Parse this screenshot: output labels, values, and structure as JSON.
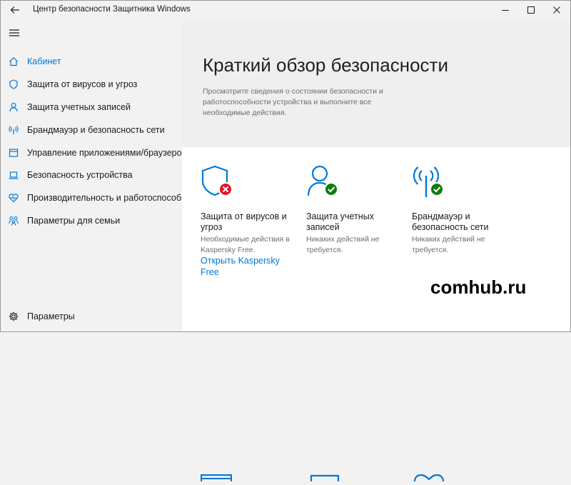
{
  "window": {
    "title": "Центр безопасности Защитника Windows"
  },
  "sidebar": {
    "items": [
      {
        "label": "Кабинет",
        "icon": "home-icon",
        "active": true
      },
      {
        "label": "Защита от вирусов и угроз",
        "icon": "shield-icon"
      },
      {
        "label": "Защита учетных записей",
        "icon": "person-icon"
      },
      {
        "label": "Брандмауэр и безопасность сети",
        "icon": "antenna-icon"
      },
      {
        "label": "Управление приложениями/браузером",
        "icon": "app-window-icon"
      },
      {
        "label": "Безопасность устройства",
        "icon": "laptop-icon"
      },
      {
        "label": "Производительность и работоспособность устройства",
        "icon": "heart-icon"
      },
      {
        "label": "Параметры для семьи",
        "icon": "family-icon"
      }
    ],
    "settings_label": "Параметры"
  },
  "main": {
    "title": "Краткий обзор безопасности",
    "description": "Просмотрите сведения о состоянии безопасности и работоспособности устройства и выполните все необходимые действия.",
    "tiles": [
      {
        "title": "Защита от вирусов и угроз",
        "status": "Необходимые действия в Kaspersky Free.",
        "link": "Открыть Kaspersky Free",
        "icon": "shield-icon",
        "badge": "error-badge-icon"
      },
      {
        "title": "Защита учетных записей",
        "status": "Никаких действий не требуется.",
        "icon": "person-icon",
        "badge": "check-badge-icon"
      },
      {
        "title": "Брандмауэр и безопасность сети",
        "status": "Никаких действий не требуется.",
        "icon": "antenna-icon",
        "badge": "check-badge-icon"
      }
    ]
  },
  "watermark": "comhub.ru",
  "colors": {
    "accent": "#0078d7",
    "error": "#e81123",
    "ok": "#107c10",
    "sidebar_bg": "#f2f2f2",
    "header_bg": "#efefef",
    "content_bg": "#ffffff"
  }
}
